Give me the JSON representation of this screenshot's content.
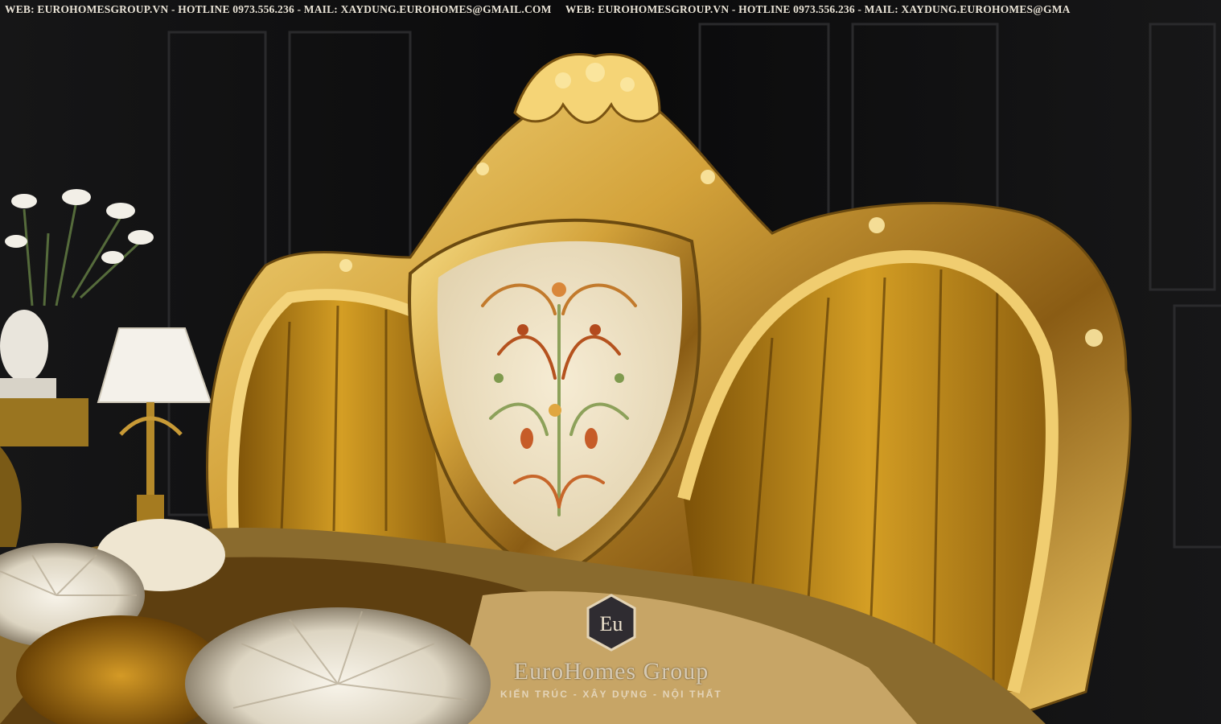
{
  "watermark_top": {
    "segments": [
      "WEB: EUROHOMESGROUP.VN - HOTLINE 0973.556.236 - MAIL: XAYDUNG.EUROHOMES@GMAIL.COM",
      "WEB: EUROHOMESGROUP.VN - HOTLINE 0973.556.236 - MAIL: XAYDUNG.EUROHOMES@GMA"
    ]
  },
  "logo": {
    "badge": "Eu",
    "brand": "EuroHomes Group",
    "tagline": "KIẾN TRÚC - XÂY DỰNG - NỘI THẤT"
  },
  "colors": {
    "background": "#0b0b0c",
    "gold": "#c99a2e",
    "velvet": "#c8931c",
    "panel": "#efe4c8"
  }
}
